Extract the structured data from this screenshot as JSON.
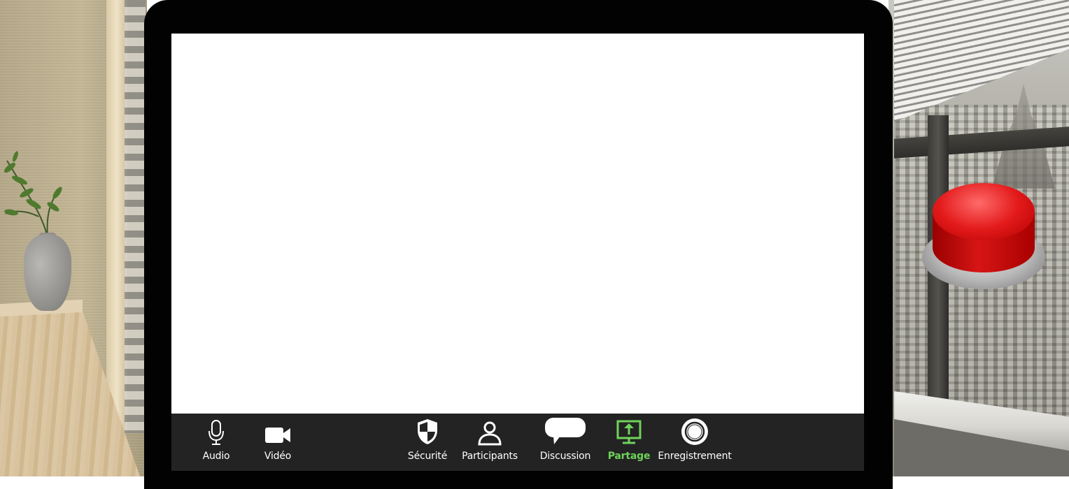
{
  "toolbar": {
    "items": [
      {
        "label": "Audio",
        "icon": "microphone-icon",
        "active": false
      },
      {
        "label": "Vidéo",
        "icon": "video-camera-icon",
        "active": false
      },
      {
        "label": "Sécurité",
        "icon": "shield-icon",
        "active": false
      },
      {
        "label": "Participants",
        "icon": "person-icon",
        "active": false
      },
      {
        "label": "Discussion",
        "icon": "chat-bubble-icon",
        "active": false
      },
      {
        "label": "Partage",
        "icon": "share-screen-icon",
        "active": true
      },
      {
        "label": "Enregistrement",
        "icon": "record-icon",
        "active": false
      }
    ]
  },
  "colors": {
    "toolbar_bg": "#232323",
    "active_accent": "#6fd35a",
    "label_default": "#ffffff",
    "alarm_button": "#d71515"
  }
}
